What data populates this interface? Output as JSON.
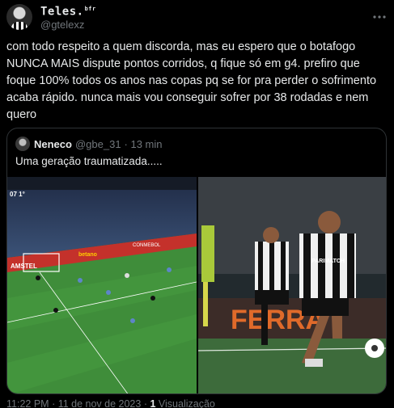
{
  "author": {
    "display_name": "Teles.",
    "badge": "bfr",
    "handle": "@gtelexz"
  },
  "tweet": {
    "text": "com todo respeito a quem discorda, mas eu espero que o botafogo NUNCA MAIS dispute pontos corridos, q fique só em g4. prefiro que foque 100% todos os anos nas copas pq se for pra perder o sofrimento acaba rápido. nunca mais vou conseguir sofrer por 38 rodadas e nem quero"
  },
  "quote": {
    "name": "Neneco",
    "handle": "@gbe_31",
    "time": "· 13 min",
    "text": "Uma geração traumatizada.....",
    "photo_left": {
      "scoreboard": "07 1°",
      "ad_banners": [
        "AMSTEL",
        "betano",
        "CONMEBOL"
      ]
    },
    "photo_right": {
      "banner": "FERRA",
      "shirt_sponsor": "PARIMATCH"
    }
  },
  "footer": {
    "time": "11:22 PM",
    "date": "11 de nov de 2023",
    "views_count": "1",
    "views_label": "Visualização"
  },
  "colors": {
    "background": "#000000",
    "text": "#e7e9ea",
    "secondary": "#71767b",
    "border": "#2f3336",
    "pitch": "#3f8d3a"
  },
  "icons": {
    "more": "more-horizontal-icon"
  }
}
